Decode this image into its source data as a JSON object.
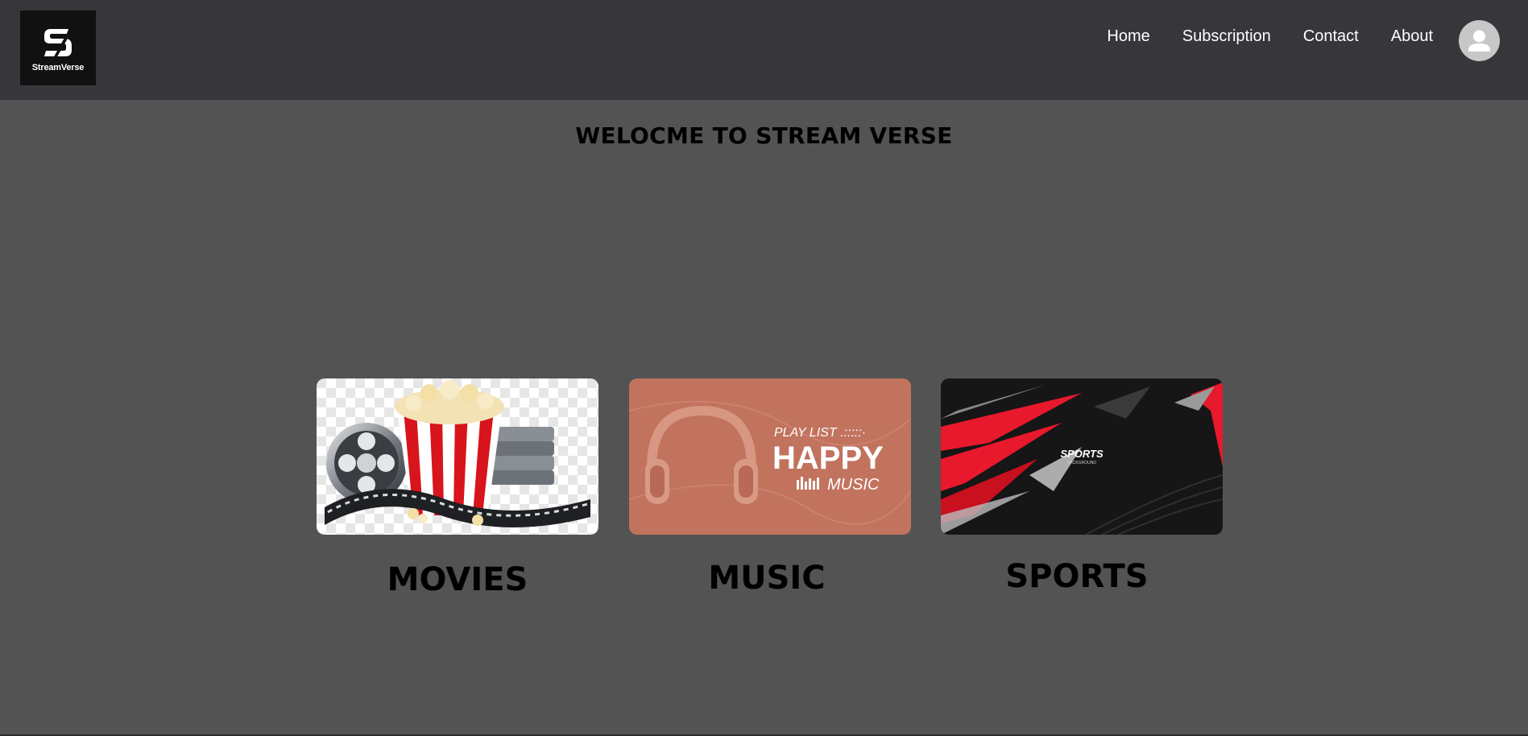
{
  "brand": {
    "name": "StreamVerse"
  },
  "nav": {
    "items": [
      "Home",
      "Subscription",
      "Contact",
      "About"
    ]
  },
  "welcome": {
    "title": "WELOCME TO STREAM VERSE"
  },
  "categories": [
    {
      "label": "MOVIES"
    },
    {
      "label": "MUSIC",
      "banner": {
        "line1": "PLAY LIST .:::::·",
        "line2": "HAPPY",
        "line3": "MUSIC"
      }
    },
    {
      "label": "SPORTS",
      "banner": {
        "line1": "SPORTS",
        "line2": "BACKGROUND"
      }
    }
  ],
  "colors": {
    "header_bg": "#37363b",
    "page_bg": "#535353",
    "music_card": "#c2735e",
    "sports_accent": "#e8192c"
  },
  "icons": {
    "logo": "streamverse-s-logo",
    "avatar": "user-avatar-icon"
  }
}
